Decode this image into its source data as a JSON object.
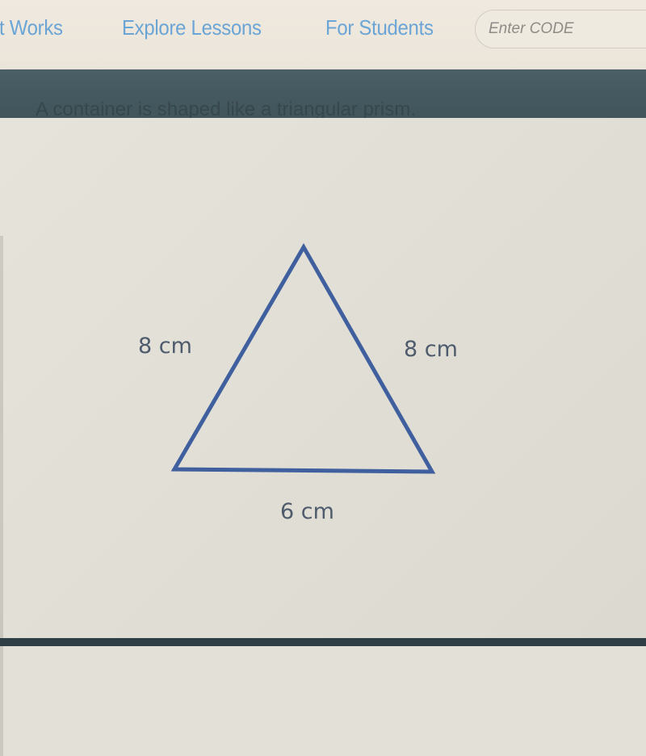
{
  "nav": {
    "links": [
      {
        "label": "it Works"
      },
      {
        "label": "Explore Lessons"
      },
      {
        "label": "For Students"
      }
    ],
    "code_input": {
      "placeholder": "Enter CODE",
      "value": ""
    }
  },
  "question": {
    "text": "A container is shaped like a triangular prism."
  },
  "figure": {
    "shape": "triangle",
    "stroke_color": "#3f5f9e",
    "label_color": "#4e5b6d",
    "sides": {
      "left": "8 cm",
      "right": "8 cm",
      "base": "6 cm"
    }
  },
  "colors": {
    "nav_background": "#ece6dc",
    "nav_link": "#6aa5d6",
    "band": "#44595f",
    "content_background": "#e2e0d6"
  }
}
